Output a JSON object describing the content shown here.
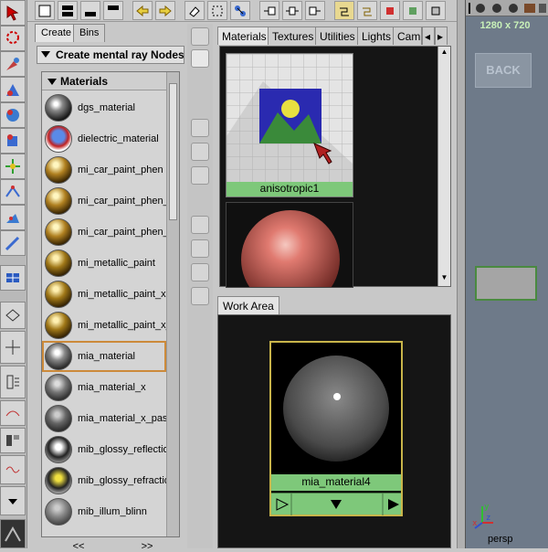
{
  "create_panel": {
    "tabs": [
      "Create",
      "Bins"
    ],
    "dropdown_label": "Create mental ray Nodes",
    "category_label": "Materials",
    "items": [
      "dgs_material",
      "dielectric_material",
      "mi_car_paint_phen",
      "mi_car_paint_phen_",
      "mi_car_paint_phen_",
      "mi_metallic_paint",
      "mi_metallic_paint_x",
      "mi_metallic_paint_x_",
      "mia_material",
      "mia_material_x",
      "mia_material_x_pass",
      "mib_glossy_reflectio",
      "mib_glossy_refractio",
      "mib_illum_blinn"
    ],
    "selected_item": "mia_material",
    "prev_label": "<<",
    "next_label": ">>"
  },
  "viewer": {
    "tabs": [
      "Materials",
      "Textures",
      "Utilities",
      "Lights",
      "Cam"
    ],
    "active_tab": "Materials",
    "swatches": [
      "anisotropic1"
    ]
  },
  "work_area": {
    "tab": "Work Area",
    "node_name": "mia_material4"
  },
  "viewport": {
    "resolution": "1280 x 720",
    "back_label": "BACK",
    "camera": "persp"
  },
  "colors": {
    "caption_green": "#7ec87a",
    "selection_orange": "#cc8a3a",
    "node_border": "#c8b44a",
    "viewport_bg": "#6e7a89"
  }
}
